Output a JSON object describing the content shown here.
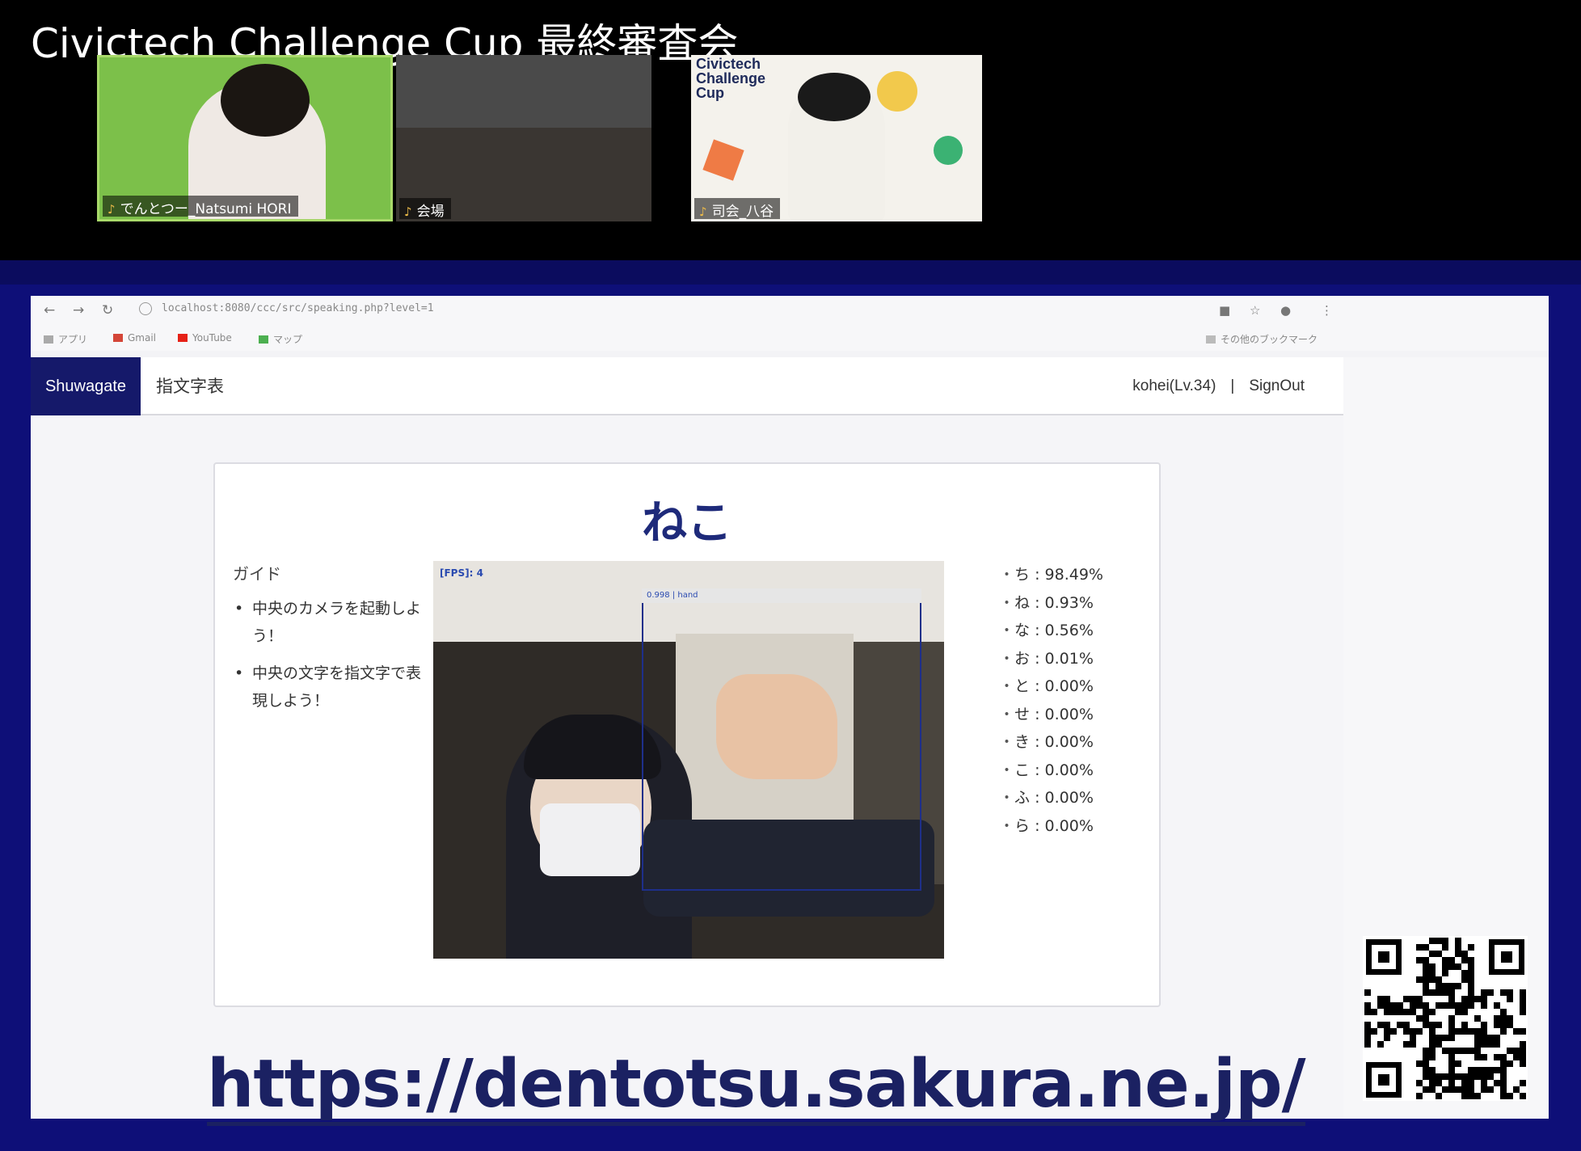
{
  "stream": {
    "title": "Civictech Challenge Cup 最終審査会"
  },
  "participants": [
    {
      "name": "でんとつー_Natsumi HORI",
      "active_speaker": true
    },
    {
      "name": "会場",
      "active_speaker": false
    },
    {
      "name": "司会_八谷",
      "active_speaker": false
    }
  ],
  "tile3_background_text": "Civictech Challenge Cup",
  "browser": {
    "url": "localhost:8080/ccc/src/speaking.php?level=1",
    "bookmarks": [
      "アプリ",
      "Gmail",
      "YouTube",
      "マップ"
    ],
    "other_bookmarks": "その他のブックマーク"
  },
  "app": {
    "brand": "Shuwagate",
    "nav_link": "指文字表",
    "user": "kohei(Lv.34)",
    "separator": "|",
    "signout": "SignOut"
  },
  "card": {
    "target_word": "ねこ",
    "guide_title": "ガイド",
    "guide_items": [
      "中央のカメラを起動しよう！",
      "中央の文字を指文字で表現しよう！"
    ],
    "fps_label": "[FPS]: 4",
    "bbox_label": "0.998 | hand",
    "predictions": [
      {
        "char": "ち",
        "percent": "98.49%"
      },
      {
        "char": "ね",
        "percent": "0.93%"
      },
      {
        "char": "な",
        "percent": "0.56%"
      },
      {
        "char": "お",
        "percent": "0.01%"
      },
      {
        "char": "と",
        "percent": "0.00%"
      },
      {
        "char": "せ",
        "percent": "0.00%"
      },
      {
        "char": "き",
        "percent": "0.00%"
      },
      {
        "char": "こ",
        "percent": "0.00%"
      },
      {
        "char": "ふ",
        "percent": "0.00%"
      },
      {
        "char": "ら",
        "percent": "0.00%"
      }
    ]
  },
  "footer_url": "https://dentotsu.sakura.ne.jp/",
  "colors": {
    "share_background": "#0e0f78",
    "brand_background": "#15196a",
    "target_word": "#1e2a7a",
    "footer_url": "#1b2162"
  }
}
